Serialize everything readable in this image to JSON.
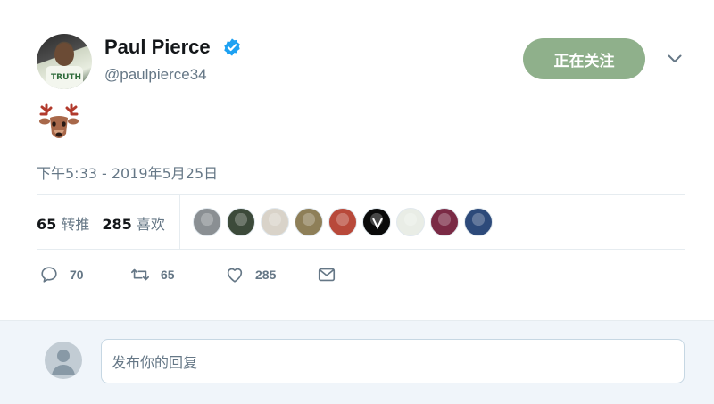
{
  "user": {
    "name": "Paul Pierce",
    "handle": "@paulpierce34",
    "verified": true,
    "avatar_text": "TRUTH"
  },
  "follow_button": {
    "label": "正在关注",
    "color": "#8fb08b"
  },
  "tweet": {
    "content_emoji": "deer-emoji",
    "timestamp": "下午5:33 - 2019年5月25日"
  },
  "stats": {
    "retweets_count": "65",
    "retweets_label": "转推",
    "likes_count": "285",
    "likes_label": "喜欢"
  },
  "likers": [
    {
      "id": "liker-1",
      "color": "#8a8f93"
    },
    {
      "id": "liker-2",
      "color": "#3c4a3a"
    },
    {
      "id": "liker-3",
      "color": "#d9d3c9"
    },
    {
      "id": "liker-4",
      "color": "#8e7f58"
    },
    {
      "id": "liker-5",
      "color": "#b8493a"
    },
    {
      "id": "liker-6",
      "color": "#0a0a0a"
    },
    {
      "id": "liker-7",
      "color": "#e9ede6"
    },
    {
      "id": "liker-8",
      "color": "#7a2a45"
    },
    {
      "id": "liker-9",
      "color": "#2d4a7a"
    }
  ],
  "actions": {
    "reply_count": "70",
    "retweet_count": "65",
    "like_count": "285"
  },
  "reply": {
    "placeholder": "发布你的回复"
  },
  "colors": {
    "accent": "#1da1f2",
    "muted": "#657786",
    "follow_bg": "#8fb08b"
  }
}
